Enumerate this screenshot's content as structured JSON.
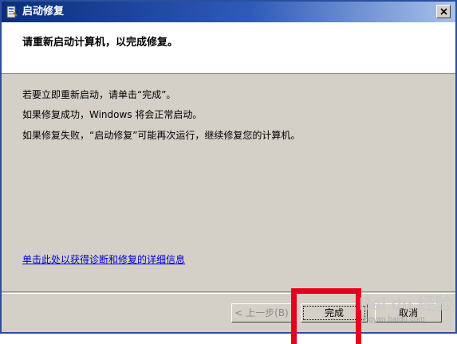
{
  "window": {
    "title": "启动修复",
    "close_label": "×"
  },
  "header": {
    "instruction": "请重新启动计算机，以完成修复。"
  },
  "content": {
    "messages": [
      "若要立即重新启动，请单击“完成”。",
      "如果修复成功，Windows 将会正常启动。",
      "如果修复失败，“启动修复”可能再次运行，继续修复您的计算机。"
    ],
    "details_link": "单击此处以获得诊断和修复的详细信息"
  },
  "footer": {
    "back_label": "< 上一步(B)",
    "finish_label": "完成",
    "cancel_label": "取消"
  },
  "watermark": {
    "logo": "Bai du 经验",
    "sub": "jingyan.baidu.com"
  },
  "colors": {
    "titlebar_start": "#0a2e7c",
    "titlebar_end": "#a8c2ea",
    "dialog_bg": "#d4d0c8",
    "link": "#0000cc",
    "highlight": "#e8001c"
  },
  "icons": {
    "app": "startup-repair-icon",
    "close": "close-icon"
  }
}
